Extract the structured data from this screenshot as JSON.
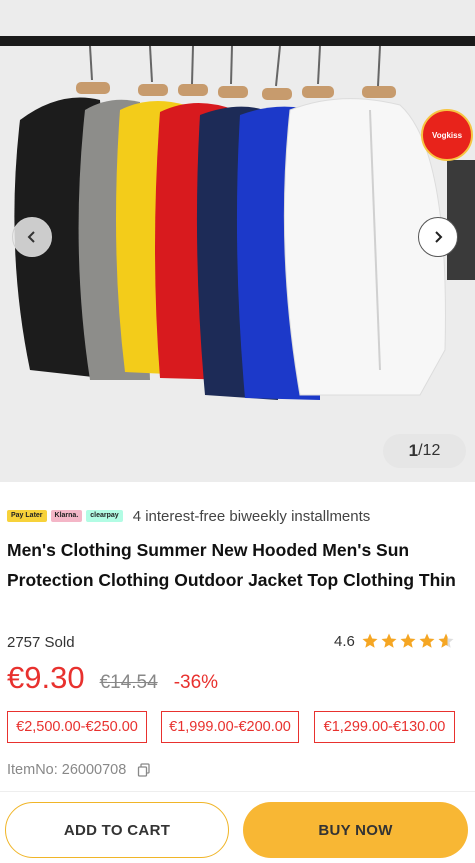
{
  "gallery": {
    "current": "1",
    "total": "/12",
    "prev_icon": "chevron-left-icon",
    "next_icon": "chevron-right-icon",
    "badge_text": "Vogkiss"
  },
  "payment": {
    "logos": [
      "Pay Later",
      "Klarna.",
      "clearpay"
    ],
    "text": "4 interest-free biweekly installments"
  },
  "product": {
    "title": "Men's Clothing Summer New Hooded Men's Sun Protection Clothing Outdoor Jacket Top Clothing Thin",
    "sold": "2757 Sold",
    "rating": "4.6",
    "rating_value": 4.6,
    "rating_max": 5,
    "price": "€9.30",
    "original_price": "€14.54",
    "discount": "-36%",
    "tiers": [
      "€2,500.00-€250.00",
      "€1,999.00-€200.00",
      "€1,299.00-€130.00"
    ],
    "item_no": "ItemNo: 26000708"
  },
  "actions": {
    "add_to_cart": "ADD TO CART",
    "buy_now": "BUY NOW"
  },
  "colors": {
    "accent_red": "#e8312e",
    "button_yellow": "#f8b734",
    "star": "#f5a623"
  }
}
